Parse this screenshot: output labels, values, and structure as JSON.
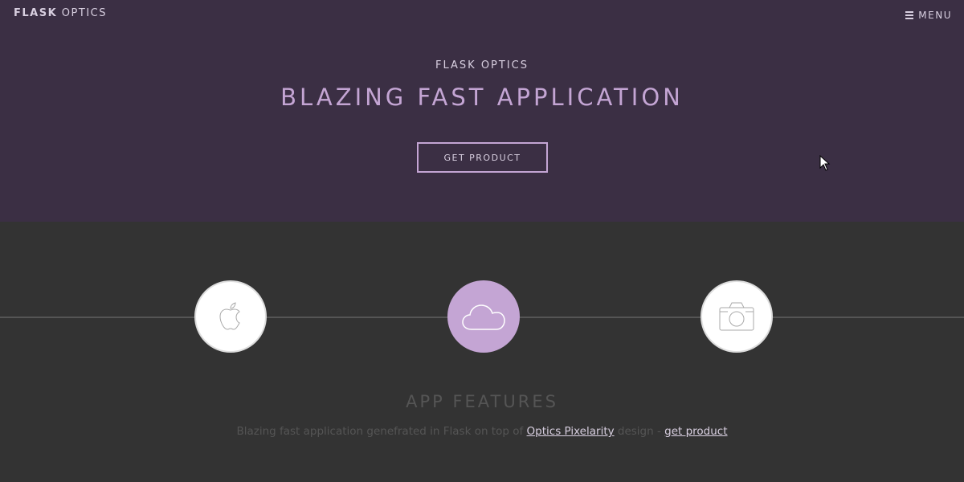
{
  "header": {
    "brand_bold": "FLASK",
    "brand_light": " OPTICS",
    "menu_label": "MENU",
    "menu_icon": "hamburger-icon"
  },
  "hero": {
    "subtitle": "FLASK OPTICS",
    "title": "BLAZING FAST APPLICATION",
    "cta_label": "GET PRODUCT"
  },
  "features": {
    "icons": [
      {
        "name": "apple-icon",
        "active": false
      },
      {
        "name": "cloud-icon",
        "active": true
      },
      {
        "name": "camera-icon",
        "active": false
      }
    ],
    "title": "APP FEATURES",
    "desc_prefix": "Blazing fast application genefrated in Flask on top of ",
    "desc_link1": "Optics Pixelarity",
    "desc_middle": " design - ",
    "desc_link2": "get product"
  },
  "colors": {
    "hero_bg": "#3b2f44",
    "features_bg": "#333333",
    "accent": "#c4a5d4"
  }
}
